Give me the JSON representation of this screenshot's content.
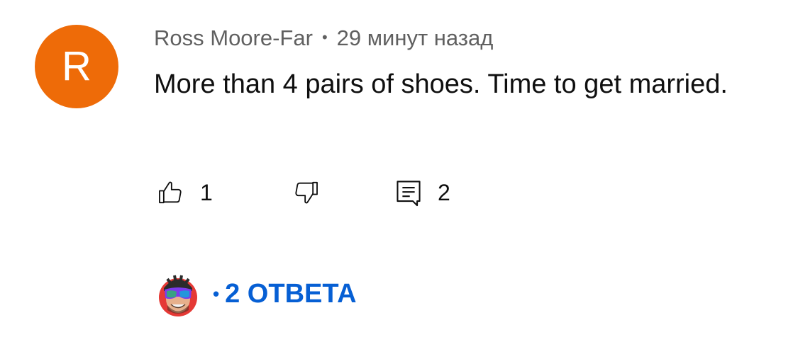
{
  "comment": {
    "author_initial": "R",
    "avatar_color": "#ee6b08",
    "author": "Ross Moore-Far",
    "separator": "•",
    "timestamp": "29 минут назад",
    "text": "More than 4 pairs of shoes. Time to get married.",
    "likes": "1",
    "replies_count": "2"
  },
  "replies": {
    "bullet": "•",
    "label": "2 ОТВЕТА",
    "link_color": "#065fd4"
  },
  "icons": {
    "like": "thumb-up-icon",
    "dislike": "thumb-down-icon",
    "reply": "comment-reply-icon",
    "creator_avatar": "creator-avatar-icon"
  }
}
